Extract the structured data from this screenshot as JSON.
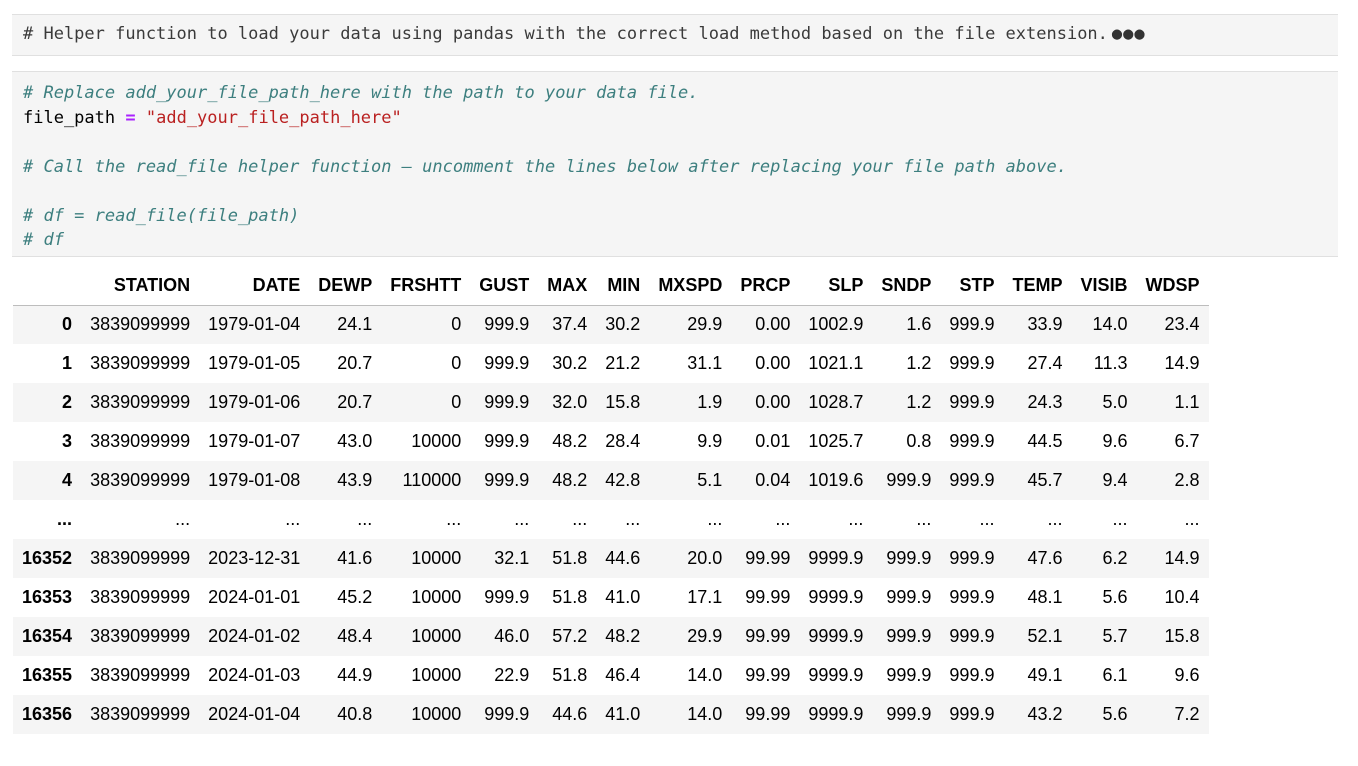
{
  "cell1": {
    "text": "# Helper function to load your data using pandas with the correct load method based on the file extension.",
    "ellipsis": "●●●"
  },
  "cell2": {
    "comment1": "# Replace add_your_file_path_here with the path to your data file.",
    "var_name": "file_path",
    "operator": "=",
    "string_value": "\"add_your_file_path_here\"",
    "comment2": "# Call the read_file helper function — uncomment the lines below after replacing your file path above.",
    "comment3": "# df = read_file(file_path)",
    "comment4": "# df"
  },
  "table": {
    "columns": [
      "",
      "STATION",
      "DATE",
      "DEWP",
      "FRSHTT",
      "GUST",
      "MAX",
      "MIN",
      "MXSPD",
      "PRCP",
      "SLP",
      "SNDP",
      "STP",
      "TEMP",
      "VISIB",
      "WDSP"
    ],
    "rows": [
      [
        "0",
        "3839099999",
        "1979-01-04",
        "24.1",
        "0",
        "999.9",
        "37.4",
        "30.2",
        "29.9",
        "0.00",
        "1002.9",
        "1.6",
        "999.9",
        "33.9",
        "14.0",
        "23.4"
      ],
      [
        "1",
        "3839099999",
        "1979-01-05",
        "20.7",
        "0",
        "999.9",
        "30.2",
        "21.2",
        "31.1",
        "0.00",
        "1021.1",
        "1.2",
        "999.9",
        "27.4",
        "11.3",
        "14.9"
      ],
      [
        "2",
        "3839099999",
        "1979-01-06",
        "20.7",
        "0",
        "999.9",
        "32.0",
        "15.8",
        "1.9",
        "0.00",
        "1028.7",
        "1.2",
        "999.9",
        "24.3",
        "5.0",
        "1.1"
      ],
      [
        "3",
        "3839099999",
        "1979-01-07",
        "43.0",
        "10000",
        "999.9",
        "48.2",
        "28.4",
        "9.9",
        "0.01",
        "1025.7",
        "0.8",
        "999.9",
        "44.5",
        "9.6",
        "6.7"
      ],
      [
        "4",
        "3839099999",
        "1979-01-08",
        "43.9",
        "110000",
        "999.9",
        "48.2",
        "42.8",
        "5.1",
        "0.04",
        "1019.6",
        "999.9",
        "999.9",
        "45.7",
        "9.4",
        "2.8"
      ],
      [
        "...",
        "...",
        "...",
        "...",
        "...",
        "...",
        "...",
        "...",
        "...",
        "...",
        "...",
        "...",
        "...",
        "...",
        "...",
        "..."
      ],
      [
        "16352",
        "3839099999",
        "2023-12-31",
        "41.6",
        "10000",
        "32.1",
        "51.8",
        "44.6",
        "20.0",
        "99.99",
        "9999.9",
        "999.9",
        "999.9",
        "47.6",
        "6.2",
        "14.9"
      ],
      [
        "16353",
        "3839099999",
        "2024-01-01",
        "45.2",
        "10000",
        "999.9",
        "51.8",
        "41.0",
        "17.1",
        "99.99",
        "9999.9",
        "999.9",
        "999.9",
        "48.1",
        "5.6",
        "10.4"
      ],
      [
        "16354",
        "3839099999",
        "2024-01-02",
        "48.4",
        "10000",
        "46.0",
        "57.2",
        "48.2",
        "29.9",
        "99.99",
        "9999.9",
        "999.9",
        "999.9",
        "52.1",
        "5.7",
        "15.8"
      ],
      [
        "16355",
        "3839099999",
        "2024-01-03",
        "44.9",
        "10000",
        "22.9",
        "51.8",
        "46.4",
        "14.0",
        "99.99",
        "9999.9",
        "999.9",
        "999.9",
        "49.1",
        "6.1",
        "9.6"
      ],
      [
        "16356",
        "3839099999",
        "2024-01-04",
        "40.8",
        "10000",
        "999.9",
        "44.6",
        "41.0",
        "14.0",
        "99.99",
        "9999.9",
        "999.9",
        "999.9",
        "43.2",
        "5.6",
        "7.2"
      ]
    ]
  }
}
